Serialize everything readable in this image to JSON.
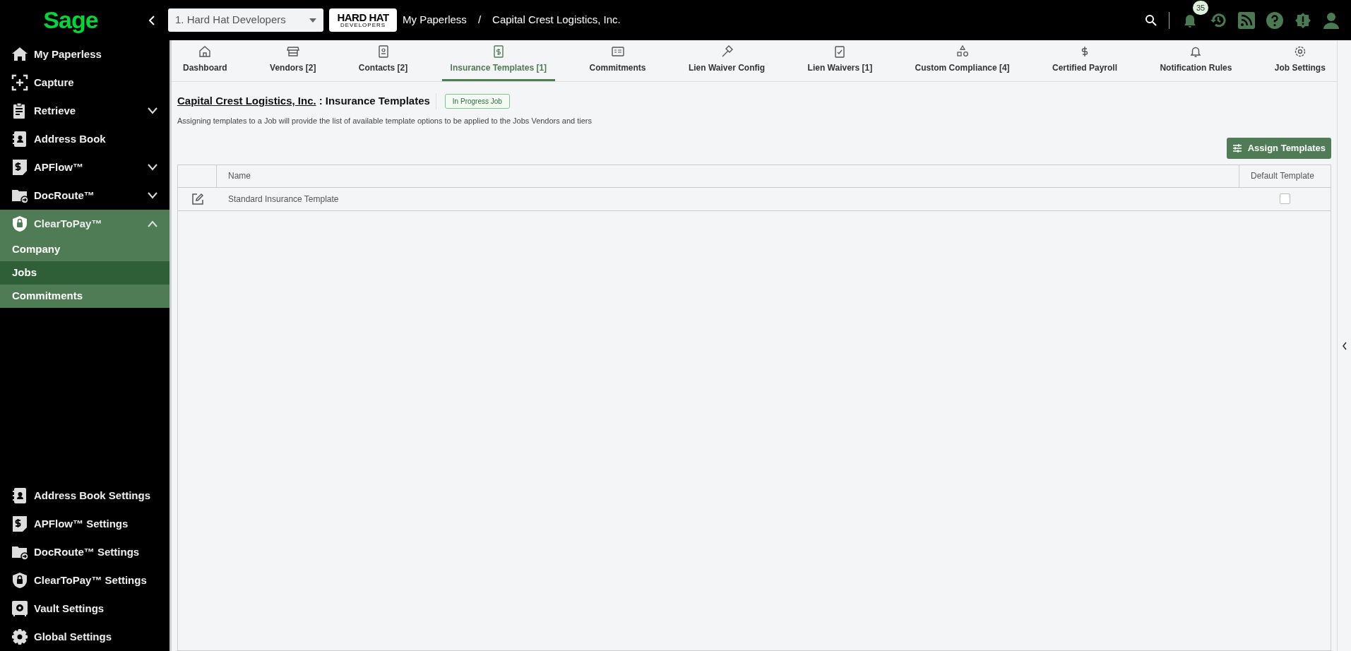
{
  "topbar": {
    "logo": "Sage",
    "company_select": {
      "value": "1. Hard Hat Developers"
    },
    "company_logo": {
      "title": "HARD HAT",
      "subtitle": "DEVELOPERS"
    },
    "breadcrumb": [
      "My Paperless",
      "Capital Crest Logistics, Inc."
    ],
    "breadcrumb_separator": "/",
    "notification_count": "35"
  },
  "sidebar": {
    "items": [
      {
        "label": "My Paperless",
        "kind": "link"
      },
      {
        "label": "Capture",
        "kind": "link"
      },
      {
        "label": "Retrieve",
        "kind": "group",
        "expanded": false
      },
      {
        "label": "Address Book",
        "kind": "link"
      },
      {
        "label": "APFlow™",
        "kind": "group",
        "expanded": false
      },
      {
        "label": "DocRoute™",
        "kind": "group",
        "expanded": false
      },
      {
        "label": "ClearToPay™",
        "kind": "group",
        "expanded": true,
        "children": [
          {
            "label": "Company",
            "selected": false
          },
          {
            "label": "Jobs",
            "selected": true
          },
          {
            "label": "Commitments",
            "selected": false
          }
        ]
      }
    ],
    "settings": [
      "Address Book Settings",
      "APFlow™ Settings",
      "DocRoute™ Settings",
      "ClearToPay™ Settings",
      "Vault Settings",
      "Global Settings"
    ]
  },
  "tabs": [
    {
      "label": "Dashboard",
      "selected": false
    },
    {
      "label": "Vendors [2]",
      "selected": false
    },
    {
      "label": "Contacts [2]",
      "selected": false
    },
    {
      "label": "Insurance Templates [1]",
      "selected": true
    },
    {
      "label": "Commitments",
      "selected": false
    },
    {
      "label": "Lien Waiver Config",
      "selected": false
    },
    {
      "label": "Lien Waivers [1]",
      "selected": false
    },
    {
      "label": "Custom Compliance [4]",
      "selected": false
    },
    {
      "label": "Certified Payroll",
      "selected": false
    },
    {
      "label": "Notification Rules",
      "selected": false
    },
    {
      "label": "Job Settings",
      "selected": false
    }
  ],
  "page": {
    "job_link": "Capital Crest Logistics, Inc.",
    "title_separator": ":",
    "title": "Insurance Templates",
    "status_badge": "In Progress Job",
    "description": "Assigning templates to a Job will provide the list of available template options to be applied to the Jobs Vendors and tiers",
    "assign_button": "Assign Templates"
  },
  "table": {
    "columns": [
      "Name",
      "Default Template"
    ],
    "rows": [
      {
        "name": "Standard Insurance Template",
        "checked": false
      }
    ]
  }
}
